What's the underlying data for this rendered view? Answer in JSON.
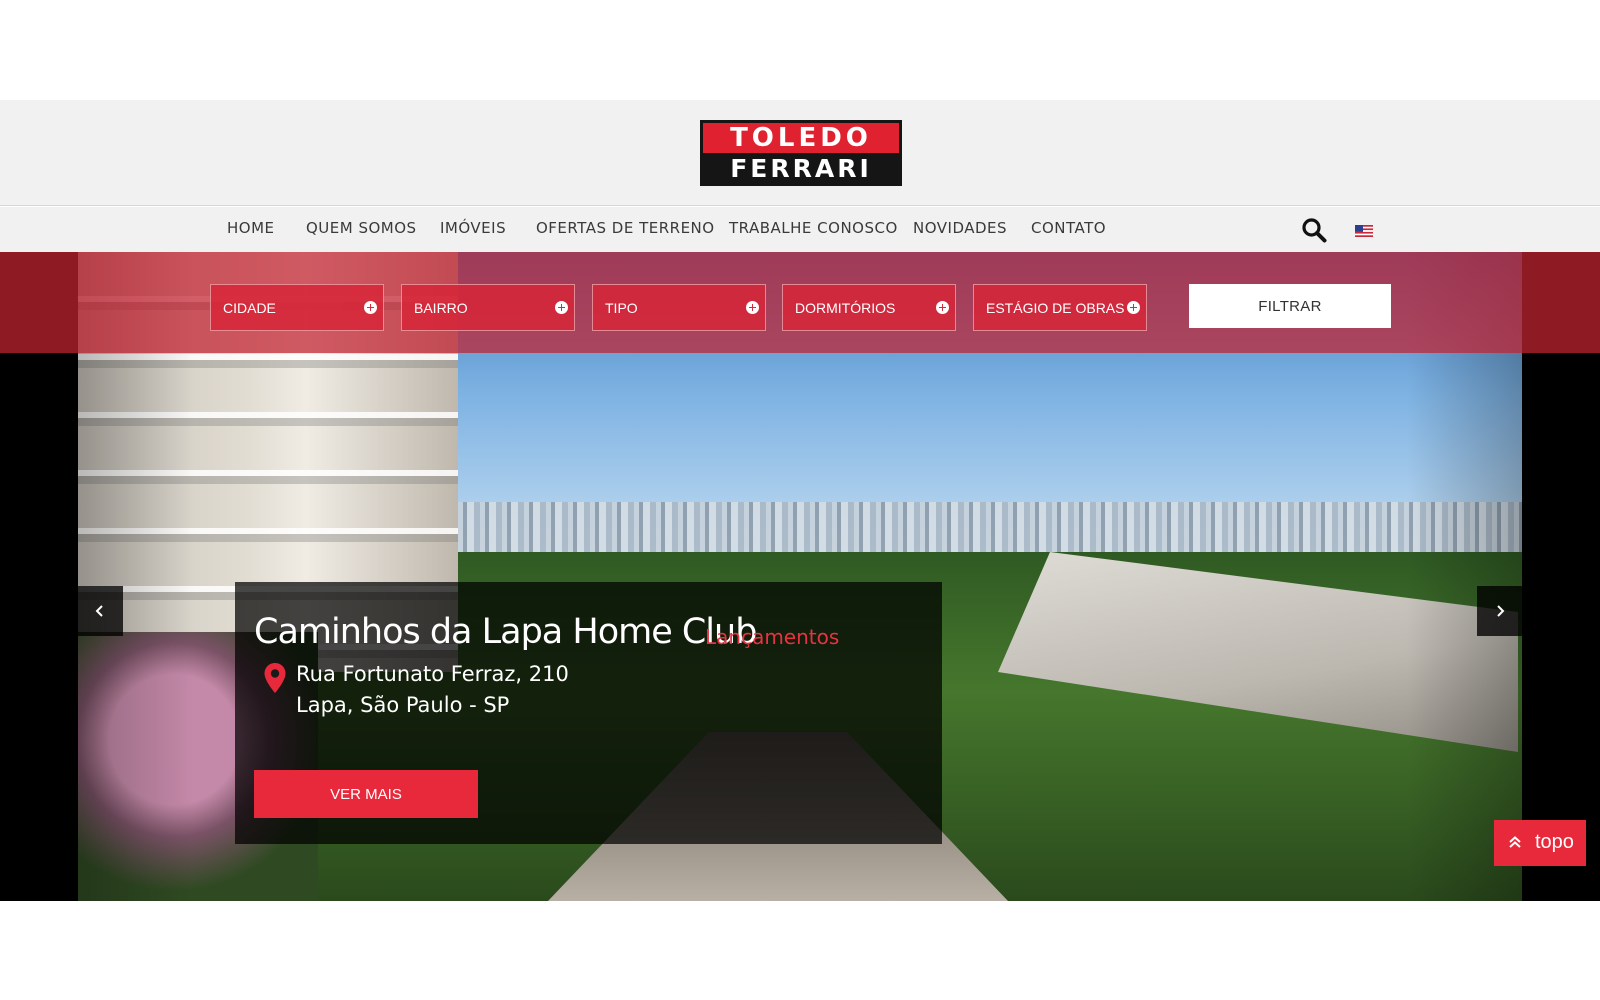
{
  "logo": {
    "line1": "TOLEDO",
    "line2": "FERRARI"
  },
  "nav": {
    "items": [
      {
        "label": "HOME"
      },
      {
        "label": "QUEM SOMOS"
      },
      {
        "label": "IMÓVEIS"
      },
      {
        "label": "OFERTAS DE TERRENO"
      },
      {
        "label": "TRABALHE CONOSCO"
      },
      {
        "label": "NOVIDADES"
      },
      {
        "label": "CONTATO"
      }
    ],
    "search_icon": "search-icon",
    "language_icon": "us-flag-icon"
  },
  "filters": {
    "items": [
      {
        "label": "CIDADE"
      },
      {
        "label": "BAIRRO"
      },
      {
        "label": "TIPO"
      },
      {
        "label": "DORMITÓRIOS"
      },
      {
        "label": "ESTÁGIO DE OBRAS"
      }
    ],
    "button_label": "FILTRAR"
  },
  "slide": {
    "title": "Caminhos da Lapa Home Club",
    "tag": "Lançamentos",
    "address_line1": "Rua Fortunato Ferraz, 210",
    "address_line2": "Lapa, São Paulo - SP",
    "cta_label": "VER MAIS"
  },
  "back_to_top": {
    "label": "topo"
  },
  "colors": {
    "accent": "#e8283b",
    "filter_bar": "#c42131",
    "header_bg": "#f1f1f1",
    "nav_text": "#3a3a3a"
  }
}
